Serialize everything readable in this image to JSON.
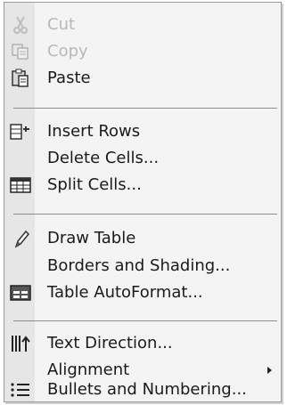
{
  "context_menu": {
    "items": [
      {
        "label": "Cut",
        "icon": "scissors-icon",
        "disabled": true
      },
      {
        "label": "Copy",
        "icon": "copy-icon",
        "disabled": true
      },
      {
        "label": "Paste",
        "icon": "paste-icon",
        "disabled": false
      },
      {
        "label": "Insert Rows",
        "icon": "insert-rows-icon",
        "disabled": false
      },
      {
        "label": "Delete Cells...",
        "icon": "",
        "disabled": false
      },
      {
        "label": "Split Cells...",
        "icon": "split-cells-icon",
        "disabled": false
      },
      {
        "label": "Draw Table",
        "icon": "pencil-icon",
        "disabled": false
      },
      {
        "label": "Borders and Shading...",
        "icon": "",
        "disabled": false
      },
      {
        "label": "Table AutoFormat...",
        "icon": "table-autoformat-icon",
        "disabled": false
      },
      {
        "label": "Text Direction...",
        "icon": "text-direction-icon",
        "disabled": false
      },
      {
        "label": "Alignment",
        "icon": "",
        "disabled": false,
        "has_submenu": true
      },
      {
        "label": "Bullets and Numbering...",
        "icon": "bullets-icon",
        "disabled": false
      }
    ]
  }
}
